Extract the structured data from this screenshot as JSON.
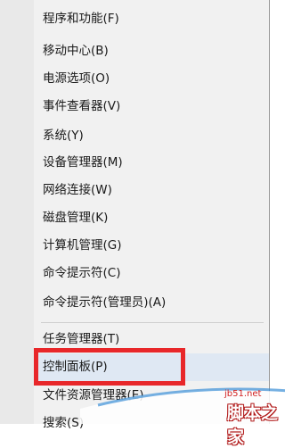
{
  "menu": {
    "items": [
      {
        "label": "程序和功能(F)"
      },
      {
        "label": "移动中心(B)"
      },
      {
        "label": "电源选项(O)"
      },
      {
        "label": "事件查看器(V)"
      },
      {
        "label": "系统(Y)"
      },
      {
        "label": "设备管理器(M)"
      },
      {
        "label": "网络连接(W)"
      },
      {
        "label": "磁盘管理(K)"
      },
      {
        "label": "计算机管理(G)"
      },
      {
        "label": "命令提示符(C)"
      },
      {
        "label": "命令提示符(管理员)(A)"
      },
      {
        "label": "任务管理器(T)"
      },
      {
        "label": "控制面板(P)"
      },
      {
        "label": "文件资源管理器(E)"
      },
      {
        "label": "搜索(S)"
      }
    ]
  },
  "highlight": {
    "color": "#e8272a"
  },
  "watermark": {
    "site": "jb51.net",
    "brand": "脚本之家"
  }
}
